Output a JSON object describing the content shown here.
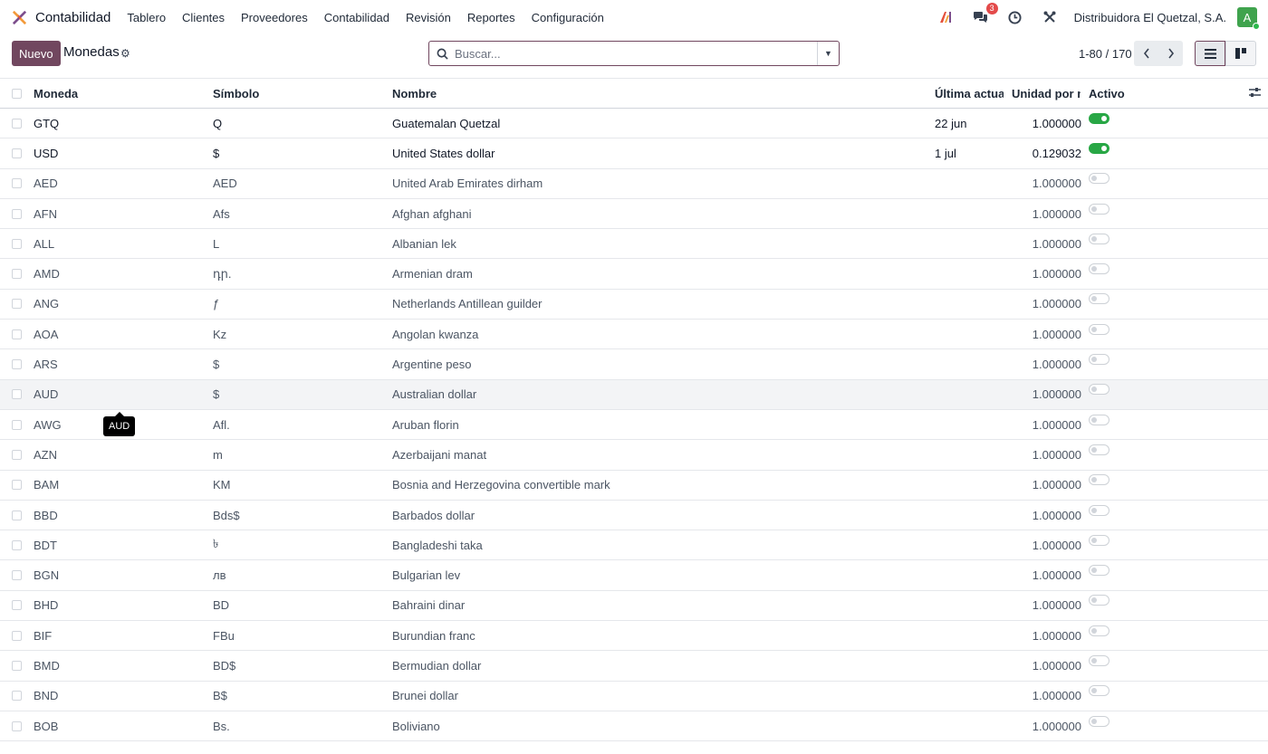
{
  "navbar": {
    "app_name": "Contabilidad",
    "menu": [
      "Tablero",
      "Clientes",
      "Proveedores",
      "Contabilidad",
      "Revisión",
      "Reportes",
      "Configuración"
    ],
    "message_count": "3",
    "company": "Distribuidora El Quetzal, S.A.",
    "avatar_letter": "A"
  },
  "control": {
    "new_label": "Nuevo",
    "title": "Monedas",
    "search_placeholder": "Buscar...",
    "pager": "1-80 / 170"
  },
  "table": {
    "headers": {
      "code": "Moneda",
      "symbol": "Símbolo",
      "name": "Nombre",
      "date": "Última actualización",
      "rate": "Unidad por moneda",
      "active": "Activo"
    },
    "rows": [
      {
        "code": "GTQ",
        "symbol": "Q",
        "name": "Guatemalan Quetzal",
        "date": "22 jun",
        "rate": "1.000000",
        "active": true
      },
      {
        "code": "USD",
        "symbol": "$",
        "name": "United States dollar",
        "date": "1 jul",
        "rate": "0.129032",
        "active": true
      },
      {
        "code": "AED",
        "symbol": "AED",
        "name": "United Arab Emirates dirham",
        "date": "",
        "rate": "1.000000",
        "active": false
      },
      {
        "code": "AFN",
        "symbol": "Afs",
        "name": "Afghan afghani",
        "date": "",
        "rate": "1.000000",
        "active": false
      },
      {
        "code": "ALL",
        "symbol": "L",
        "name": "Albanian lek",
        "date": "",
        "rate": "1.000000",
        "active": false
      },
      {
        "code": "AMD",
        "symbol": "դր.",
        "name": "Armenian dram",
        "date": "",
        "rate": "1.000000",
        "active": false
      },
      {
        "code": "ANG",
        "symbol": "ƒ",
        "name": "Netherlands Antillean guilder",
        "date": "",
        "rate": "1.000000",
        "active": false
      },
      {
        "code": "AOA",
        "symbol": "Kz",
        "name": "Angolan kwanza",
        "date": "",
        "rate": "1.000000",
        "active": false
      },
      {
        "code": "ARS",
        "symbol": "$",
        "name": "Argentine peso",
        "date": "",
        "rate": "1.000000",
        "active": false
      },
      {
        "code": "AUD",
        "symbol": "$",
        "name": "Australian dollar",
        "date": "",
        "rate": "1.000000",
        "active": false
      },
      {
        "code": "AWG",
        "symbol": "Afl.",
        "name": "Aruban florin",
        "date": "",
        "rate": "1.000000",
        "active": false
      },
      {
        "code": "AZN",
        "symbol": "m",
        "name": "Azerbaijani manat",
        "date": "",
        "rate": "1.000000",
        "active": false
      },
      {
        "code": "BAM",
        "symbol": "KM",
        "name": "Bosnia and Herzegovina convertible mark",
        "date": "",
        "rate": "1.000000",
        "active": false
      },
      {
        "code": "BBD",
        "symbol": "Bds$",
        "name": "Barbados dollar",
        "date": "",
        "rate": "1.000000",
        "active": false
      },
      {
        "code": "BDT",
        "symbol": "৳",
        "name": "Bangladeshi taka",
        "date": "",
        "rate": "1.000000",
        "active": false
      },
      {
        "code": "BGN",
        "symbol": "лв",
        "name": "Bulgarian lev",
        "date": "",
        "rate": "1.000000",
        "active": false
      },
      {
        "code": "BHD",
        "symbol": "BD",
        "name": "Bahraini dinar",
        "date": "",
        "rate": "1.000000",
        "active": false
      },
      {
        "code": "BIF",
        "symbol": "FBu",
        "name": "Burundian franc",
        "date": "",
        "rate": "1.000000",
        "active": false
      },
      {
        "code": "BMD",
        "symbol": "BD$",
        "name": "Bermudian dollar",
        "date": "",
        "rate": "1.000000",
        "active": false
      },
      {
        "code": "BND",
        "symbol": "B$",
        "name": "Brunei dollar",
        "date": "",
        "rate": "1.000000",
        "active": false
      },
      {
        "code": "BOB",
        "symbol": "Bs.",
        "name": "Boliviano",
        "date": "",
        "rate": "1.000000",
        "active": false
      }
    ]
  },
  "tooltip": {
    "text": "AUD"
  },
  "colors": {
    "brand": "#71475f",
    "toggle_on": "#28a745",
    "badge": "#e34a4a",
    "avatar": "#3fa34d"
  }
}
